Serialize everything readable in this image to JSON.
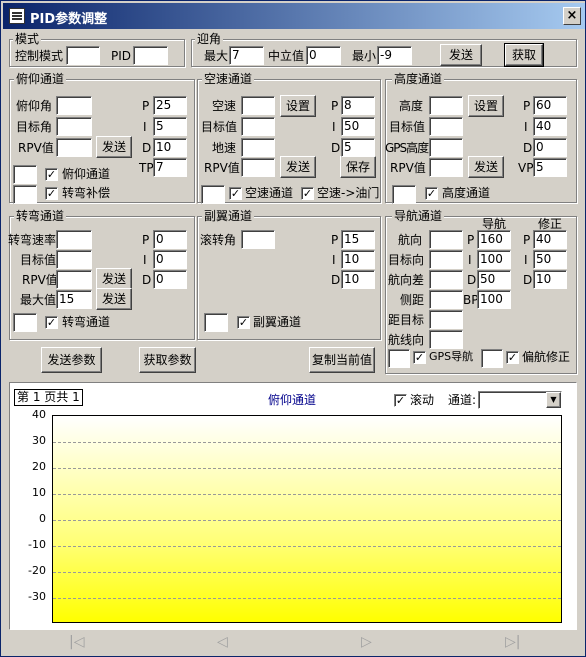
{
  "window": {
    "title": "PID参数调整",
    "close": "×"
  },
  "mode": {
    "group": "模式",
    "ctrl_label": "控制模式",
    "ctrl_value": "",
    "pid_label": "PID",
    "pid_value": ""
  },
  "attack": {
    "group": "迎角",
    "max_label": "最大",
    "max_value": "7",
    "mid_label": "中立值",
    "mid_value": "0",
    "min_label": "最小",
    "min_value": "-9",
    "send": "发送",
    "get": "获取"
  },
  "pitch": {
    "group": "俯仰通道",
    "angle_label": "俯仰角",
    "angle_value": "",
    "target_label": "目标角",
    "target_value": "",
    "rpv_label": "RPV值",
    "rpv_value": "",
    "send": "发送",
    "p_label": "P",
    "p_value": "25",
    "i_label": "I",
    "i_value": "5",
    "d_label": "D",
    "d_value": "10",
    "tp_label": "TP",
    "tp_value": "7",
    "cb1_label": "俯仰通道",
    "cb2_label": "转弯补偿",
    "cb1_checked": "✓",
    "cb2_checked": "✓"
  },
  "airspeed": {
    "group": "空速通道",
    "speed_label": "空速",
    "speed_value": "",
    "set": "设置",
    "target_label": "目标值",
    "target_value": "",
    "ground_label": "地速",
    "ground_value": "",
    "rpv_label": "RPV值",
    "rpv_value": "",
    "send": "发送",
    "save": "保存",
    "p_label": "P",
    "p_value": "8",
    "i_label": "I",
    "i_value": "50",
    "d_label": "D",
    "d_value": "5",
    "cb1_label": "空速通道",
    "cb2_label": "空速->油门",
    "cb1_checked": "✓",
    "cb2_checked": "✓"
  },
  "altitude": {
    "group": "高度通道",
    "alt_label": "高度",
    "alt_value": "",
    "set": "设置",
    "target_label": "目标值",
    "target_value": "",
    "gps_label": "GPS高度",
    "gps_value": "",
    "rpv_label": "RPV值",
    "rpv_value": "",
    "send": "发送",
    "p_label": "P",
    "p_value": "60",
    "i_label": "I",
    "i_value": "40",
    "d_label": "D",
    "d_value": "0",
    "vp_label": "VP",
    "vp_value": "5",
    "cb1_label": "高度通道",
    "cb1_checked": "✓"
  },
  "turn": {
    "group": "转弯通道",
    "rate_label": "转弯速率",
    "rate_value": "",
    "target_label": "目标值",
    "target_value": "",
    "rpv_label": "RPV值",
    "rpv_value": "",
    "send1": "发送",
    "max_label": "最大值",
    "max_value": "15",
    "send2": "发送",
    "p_label": "P",
    "p_value": "0",
    "i_label": "I",
    "i_value": "0",
    "d_label": "D",
    "d_value": "0",
    "cb1_label": "转弯通道",
    "cb1_checked": "✓"
  },
  "aileron": {
    "group": "副翼通道",
    "roll_label": "滚转角",
    "roll_value": "",
    "p_label": "P",
    "p_value": "15",
    "i_label": "I",
    "i_value": "10",
    "d_label": "D",
    "d_value": "10",
    "cb1_label": "副翼通道",
    "cb1_checked": "✓"
  },
  "nav": {
    "group": "导航通道",
    "col1": "导航",
    "col2": "修正",
    "heading_label": "航向",
    "heading_value": "",
    "target_label": "目标向",
    "target_value": "",
    "diff_label": "航向差",
    "diff_value": "",
    "offset_label": "侧距",
    "offset_value": "",
    "dist_label": "距目标",
    "dist_value": "",
    "route_label": "航线向",
    "route_value": "",
    "p1_label": "P",
    "p1_value": "160",
    "i1_label": "I",
    "i1_value": "100",
    "d1_label": "D",
    "d1_value": "50",
    "bp_label": "BP",
    "bp_value": "100",
    "p2_label": "P",
    "p2_value": "40",
    "i2_label": "I",
    "i2_value": "50",
    "d2_label": "D",
    "d2_value": "10",
    "cb1_label": "GPS导航",
    "cb2_label": "偏航修正",
    "cb1_checked": "✓",
    "cb2_checked": "✓"
  },
  "actions": {
    "send_params": "发送参数",
    "get_params": "获取参数",
    "copy_current": "复制当前值"
  },
  "chart": {
    "page": "第 1 页共 1",
    "title": "俯仰通道",
    "scroll_label": "滚动",
    "scroll_checked": "✓",
    "channel_label": "通道:",
    "channel_value": ""
  },
  "pager": {
    "first": "|◁",
    "prev": "◁",
    "next": "▷",
    "last": "▷|"
  },
  "chart_data": {
    "type": "line",
    "title": "俯仰通道",
    "series": [],
    "yticks": [
      "40",
      "30",
      "20",
      "10",
      "0",
      "-10",
      "-20",
      "-30"
    ],
    "ylim": [
      -40,
      40
    ],
    "grid": true,
    "background_top": "#ffffff",
    "background_bottom": "#ffff00"
  }
}
